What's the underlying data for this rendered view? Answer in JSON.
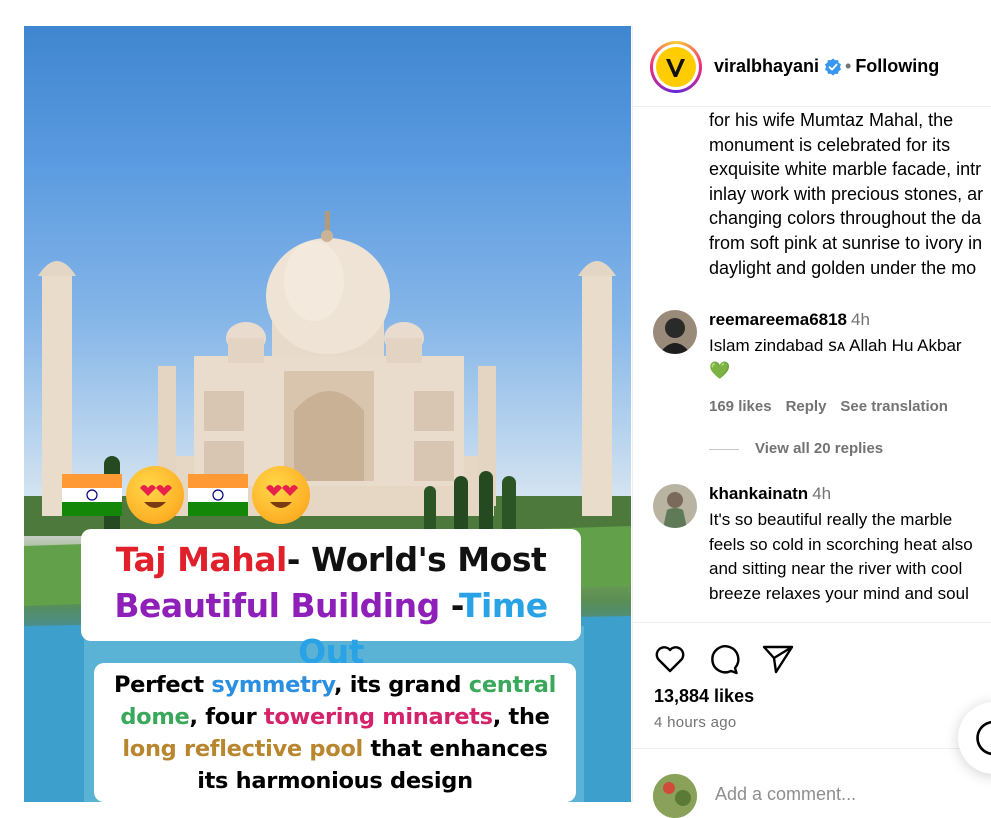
{
  "post": {
    "username": "viralbhayani",
    "follow_separator": "•",
    "follow_state": "Following"
  },
  "media": {
    "headline_part1": "Taj Mahal",
    "headline_part2": "- World's Most",
    "headline_part3": "Beautiful Building",
    "headline_part4": " -",
    "headline_part5": "Time Out",
    "sub_line1_a": "Perfect ",
    "sub_line1_b": "symmetry",
    "sub_line1_c": ", its grand ",
    "sub_line1_d": "central",
    "sub_line2_a": "dome",
    "sub_line2_b": ", four ",
    "sub_line2_c": "towering minarets",
    "sub_line2_d": ", the",
    "sub_line3_a": "long reflective pool",
    "sub_line3_b": " that enhances",
    "sub_line4": "its harmonious design"
  },
  "caption": {
    "lines": [
      "for his wife Mumtaz Mahal, the",
      "monument is celebrated for its",
      "exquisite white marble facade, intr",
      "inlay work with precious stones, ar",
      "changing colors throughout the da",
      "from soft pink at sunrise to ivory in",
      "daylight and golden under the mo"
    ]
  },
  "comments": [
    {
      "username": "reemareema6818",
      "time": "4h",
      "text_line1": "Islam zindabad ꜱᴀ Allah Hu Akbar",
      "text_line2": "💚",
      "likes": "169 likes",
      "reply": "Reply",
      "translate": "See translation"
    },
    {
      "username": "khankainatn",
      "time": "4h",
      "text_lines": [
        "It's so beautiful really the marble",
        "feels so cold in scorching heat also",
        "and sitting near the river with cool",
        "breeze relaxes your mind and soul"
      ]
    }
  ],
  "replies_link": "View all 20 replies",
  "actions": {
    "icons": [
      "heart-icon",
      "comment-icon",
      "share-icon"
    ]
  },
  "likes_count": "13,884 likes",
  "posted_time": "4 hours ago",
  "add_comment_placeholder": "Add a comment...",
  "colors": {
    "accent_verified": "#3897f0",
    "muted": "#737373",
    "divider": "#efefef"
  }
}
